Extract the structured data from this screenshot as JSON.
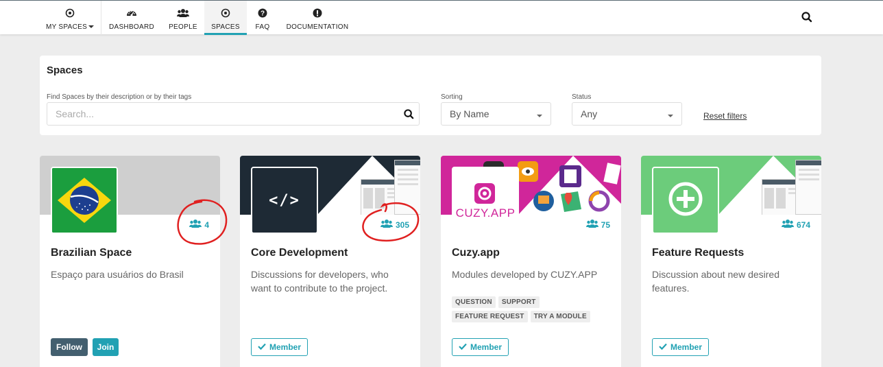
{
  "nav": {
    "items": [
      {
        "label": "MY SPACES",
        "icon": "target-icon"
      },
      {
        "label": "DASHBOARD",
        "icon": "dashboard-icon"
      },
      {
        "label": "PEOPLE",
        "icon": "users-icon"
      },
      {
        "label": "SPACES",
        "icon": "target-icon"
      },
      {
        "label": "FAQ",
        "icon": "question-icon"
      },
      {
        "label": "DOCUMENTATION",
        "icon": "exclamation-icon"
      }
    ],
    "active": "SPACES"
  },
  "filters": {
    "title": "Spaces",
    "search_label": "Find Spaces by their description or by their tags",
    "search_placeholder": "Search...",
    "sorting_label": "Sorting",
    "sorting_value": "By Name",
    "status_label": "Status",
    "status_value": "Any",
    "reset_label": "Reset filters"
  },
  "cards": [
    {
      "title": "Brazilian Space",
      "description": "Espaço para usuários do Brasil",
      "member_count": "4",
      "buttons": [
        "Follow",
        "Join"
      ]
    },
    {
      "title": "Core Development",
      "description": "Discussions for developers, who want to contribute to the project.",
      "member_count": "305",
      "logo_text": "</>",
      "button": "Member"
    },
    {
      "title": "Cuzy.app",
      "description": "Modules developed by CUZY.APP",
      "member_count": "75",
      "logo_text": "CUZY.APP",
      "tags": [
        "QUESTION",
        "SUPPORT",
        "FEATURE REQUEST",
        "TRY A MODULE"
      ],
      "button": "Member"
    },
    {
      "title": "Feature Requests",
      "description": "Discussion about new desired features.",
      "member_count": "674",
      "button": "Member"
    }
  ],
  "colors": {
    "accent": "#21a1b3",
    "follow_button": "#435f6f",
    "core_banner": "#1e2a35",
    "cuzy_banner": "#d0269a",
    "feature_banner": "#6ccc7b",
    "annotation": "#e02020"
  }
}
